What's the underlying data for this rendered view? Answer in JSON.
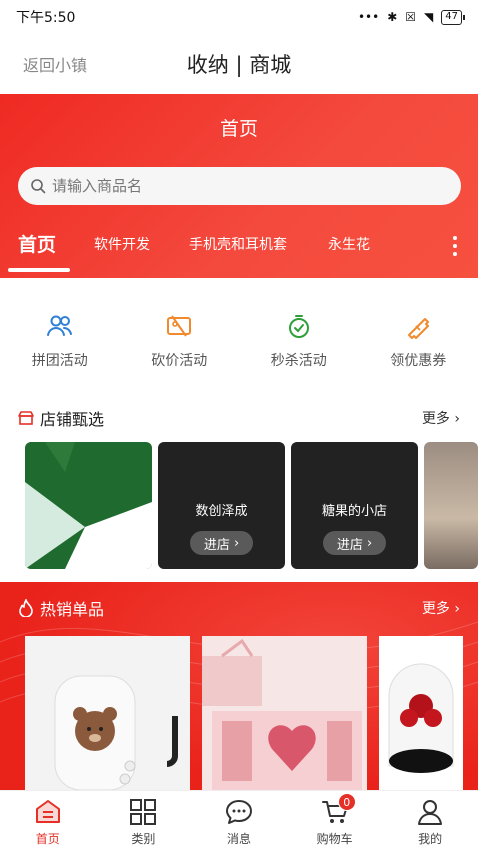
{
  "status_bar": {
    "time": "下午5:50",
    "battery": "47"
  },
  "topnav": {
    "back_label": "返回小镇",
    "title": "收纳 | 商城"
  },
  "header": {
    "title": "首页"
  },
  "search": {
    "placeholder": "请输入商品名"
  },
  "tabs": [
    {
      "label": "首页",
      "active": true
    },
    {
      "label": "软件开发"
    },
    {
      "label": "手机壳和耳机套"
    },
    {
      "label": "永生花"
    }
  ],
  "activities": [
    {
      "label": "拼团活动",
      "icon": "group-icon",
      "color": "#2f7fd6"
    },
    {
      "label": "砍价活动",
      "icon": "bargain-icon",
      "color": "#f08a2c"
    },
    {
      "label": "秒杀活动",
      "icon": "stopwatch-icon",
      "color": "#2f9f3a"
    },
    {
      "label": "领优惠券",
      "icon": "coupon-icon",
      "color": "#f08a2c"
    }
  ],
  "stores": {
    "title": "店铺甄选",
    "more": "更多",
    "items": [
      {
        "name": ""
      },
      {
        "name": "数创泽成",
        "button": "进店"
      },
      {
        "name": "糖果的小店",
        "button": "进店"
      },
      {
        "name": ""
      }
    ]
  },
  "hot": {
    "title": "热销单品",
    "more": "更多"
  },
  "bottom_nav": [
    {
      "label": "首页",
      "icon": "home-icon",
      "active": true
    },
    {
      "label": "类别",
      "icon": "category-icon"
    },
    {
      "label": "消息",
      "icon": "message-icon"
    },
    {
      "label": "购物车",
      "icon": "cart-icon",
      "badge": "0"
    },
    {
      "label": "我的",
      "icon": "profile-icon"
    }
  ],
  "colors": {
    "brand_red": "#ef2a23",
    "active_red": "#e53028"
  }
}
